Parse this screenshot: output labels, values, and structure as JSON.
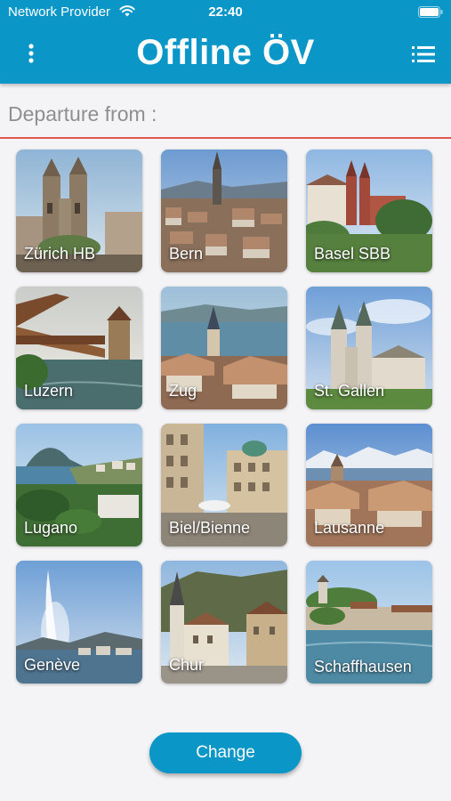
{
  "status_bar": {
    "carrier": "Network Provider",
    "time": "22:40",
    "icons": [
      "wifi-icon",
      "battery-icon"
    ]
  },
  "header": {
    "title": "Offline ÖV",
    "left_icon": "more-vertical-icon",
    "right_icon": "list-icon",
    "background": "#0b96c8"
  },
  "departure": {
    "placeholder": "Departure from :",
    "value": "",
    "underline_color": "#e0584a"
  },
  "cities": [
    {
      "label": "Zürich HB"
    },
    {
      "label": "Bern"
    },
    {
      "label": "Basel SBB"
    },
    {
      "label": "Luzern"
    },
    {
      "label": "Zug"
    },
    {
      "label": "St. Gallen"
    },
    {
      "label": "Lugano"
    },
    {
      "label": "Biel/Bienne"
    },
    {
      "label": "Lausanne"
    },
    {
      "label": "Genève"
    },
    {
      "label": "Chur"
    },
    {
      "label": "Schaffhausen"
    }
  ],
  "actions": {
    "change_label": "Change"
  }
}
